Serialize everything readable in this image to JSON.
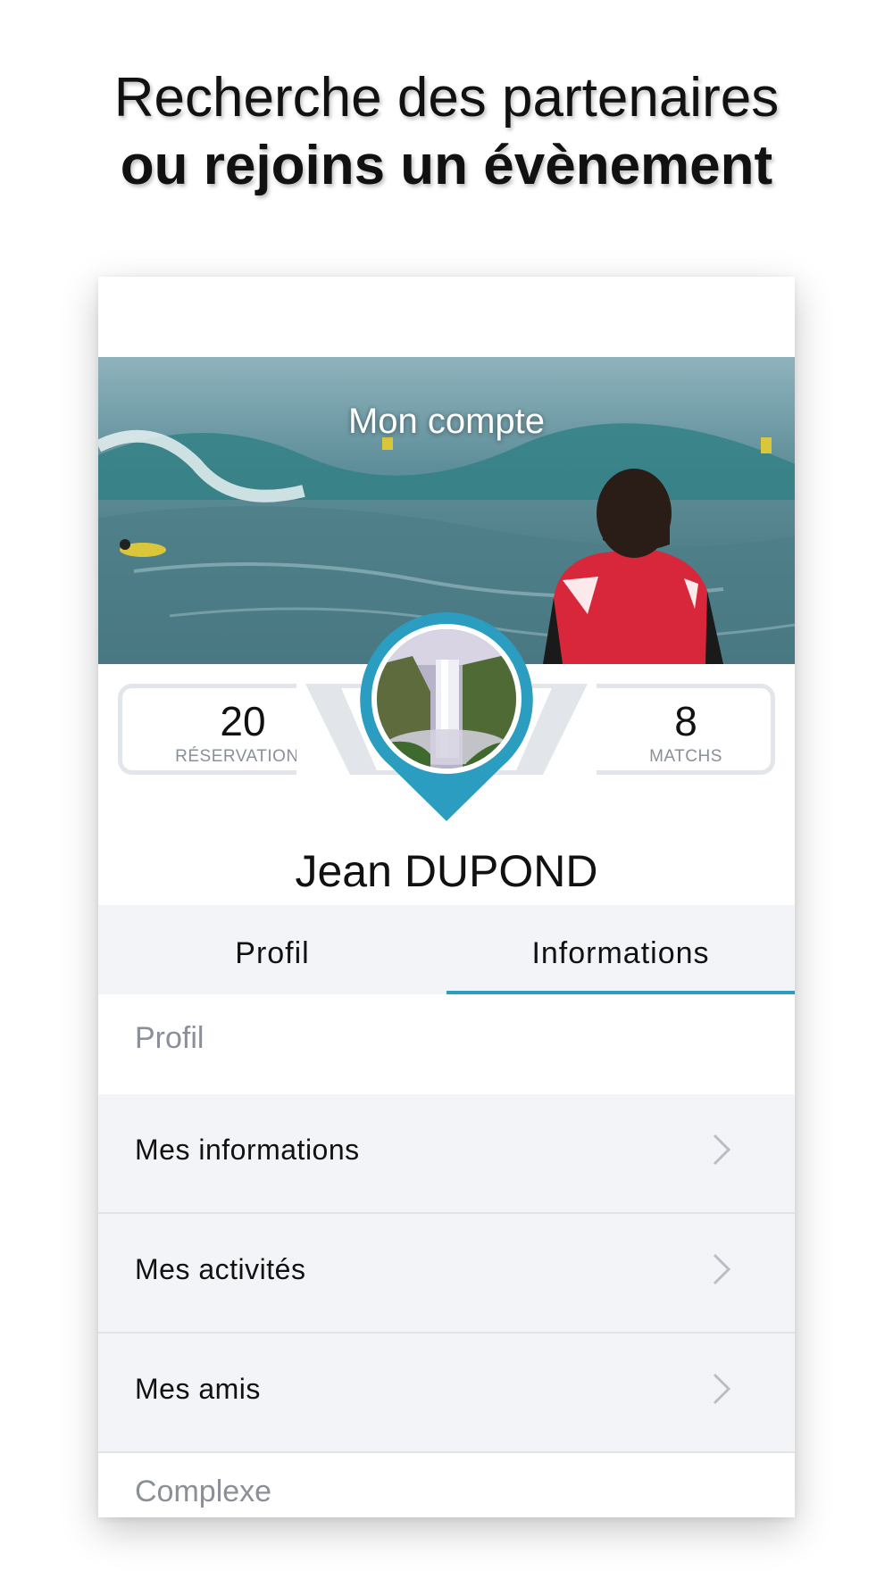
{
  "headline": {
    "line1": "Recherche des partenaires",
    "line2": "ou rejoins un évènement"
  },
  "hero": {
    "title": "Mon compte"
  },
  "stats": [
    {
      "value": "20",
      "label": "RÉSERVATIONS"
    },
    {
      "value": "8",
      "label": "MATCHS"
    }
  ],
  "user": {
    "name": "Jean  DUPOND"
  },
  "tabs": [
    {
      "label": "Profil",
      "active": false
    },
    {
      "label": "Informations",
      "active": true
    }
  ],
  "sections": {
    "profil_header": "Profil",
    "complexe_header": "Complexe"
  },
  "menu_items": [
    {
      "label": "Mes informations",
      "icon": "chevron-right-icon"
    },
    {
      "label": "Mes activités",
      "icon": "chevron-right-icon"
    },
    {
      "label": "Mes amis",
      "icon": "chevron-right-icon"
    }
  ],
  "colors": {
    "accent": "#2a9dc1",
    "row_bg": "#f3f4f8",
    "muted_text": "#8a8f98"
  }
}
